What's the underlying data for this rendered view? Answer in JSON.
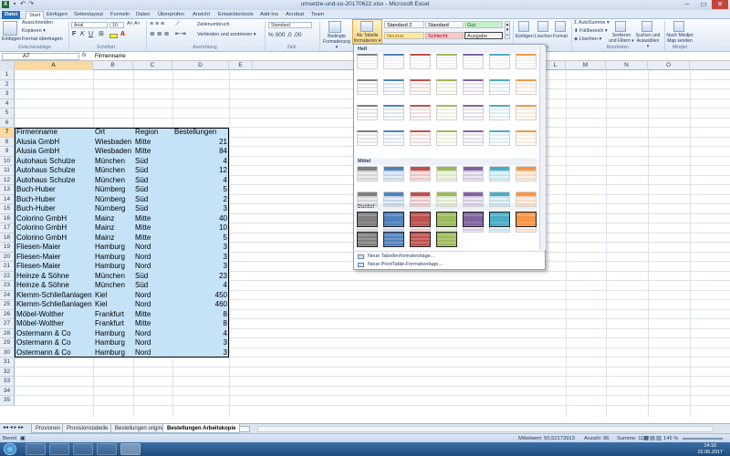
{
  "window": {
    "title": "umsetze-und-co-20170622.xlsx - Microsoft Excel"
  },
  "ribbon": {
    "tabs": [
      "Datei",
      "Start",
      "Einfügen",
      "Seitenlayout",
      "Formeln",
      "Daten",
      "Überprüfen",
      "Ansicht",
      "Entwicklertools",
      "Add-Ins",
      "Acrobat",
      "Team"
    ],
    "clipboard": {
      "paste": "Einfügen",
      "cut": "Ausschneiden",
      "copy": "Kopieren ▾",
      "format_painter": "Format übertragen",
      "group": "Zwischenablage"
    },
    "font": {
      "name": "Arial",
      "size": "10",
      "group": "Schriftart"
    },
    "alignment": {
      "wrap": "Zeilenumbruch",
      "merge": "Verbinden und zentrieren ▾",
      "group": "Ausrichtung"
    },
    "number": {
      "format": "Standard",
      "group": "Zahl"
    },
    "styles": {
      "conditional": "Bedingte Formatierung ▾",
      "as_table": "Als Tabelle formatieren ▾",
      "cells": [
        {
          "label": "Standard 2",
          "color": "#ffffff"
        },
        {
          "label": "Standard",
          "color": "#ffffff"
        },
        {
          "label": "Gut",
          "color": "#c6efce",
          "text": "#006100"
        },
        {
          "label": "Neutral",
          "color": "#ffeb9c",
          "text": "#9c6500"
        },
        {
          "label": "Schlecht",
          "color": "#ffc7ce",
          "text": "#9c0006"
        },
        {
          "label": "Ausgabe",
          "color": "#f2f2f2",
          "text": "#3f3f3f"
        }
      ]
    },
    "cells": {
      "insert": "Einfügen",
      "delete": "Löschen",
      "format": "Format",
      "group": "Zellen"
    },
    "editing": {
      "autosum": "AutoSumme ▾",
      "fill": "Füllbereich ▾",
      "clear": "Löschen ▾",
      "sort": "Sortieren und Filtern ▾",
      "find": "Suchen und Auswählen ▾",
      "group": "Bearbeiten"
    },
    "mindjet": {
      "send": "Nach Mindjet Map senden",
      "group": "Mindjet"
    }
  },
  "formula_bar": {
    "cell": "A7",
    "fx": "fx",
    "value": "Firmenname"
  },
  "columns": [
    "A",
    "B",
    "C",
    "D",
    "E",
    "F",
    "G",
    "H",
    "I",
    "J",
    "K",
    "L",
    "M",
    "N",
    "O"
  ],
  "selected_column": "A",
  "rows": [
    "1",
    "2",
    "3",
    "4",
    "5",
    "6",
    "7",
    "8",
    "9",
    "10",
    "11",
    "12",
    "13",
    "14",
    "15",
    "16",
    "17",
    "18",
    "19",
    "20",
    "21",
    "22",
    "23",
    "24",
    "25",
    "26",
    "27",
    "28",
    "29",
    "30",
    "31",
    "32",
    "33",
    "34",
    "35"
  ],
  "selected_row": "7",
  "table": {
    "headers": [
      "Firmenname",
      "Ort",
      "Region",
      "Bestellungen"
    ],
    "rows": [
      [
        "Alusia GmbH",
        "Wiesbaden",
        "Mitte",
        "21"
      ],
      [
        "Alusia GmbH",
        "Wiesbaden",
        "Mitte",
        "84"
      ],
      [
        "Autohaus Schulze",
        "München",
        "Süd",
        "4"
      ],
      [
        "Autohaus Schulze",
        "München",
        "Süd",
        "12"
      ],
      [
        "Autohaus Schulze",
        "München",
        "Süd",
        "4"
      ],
      [
        "Buch-Huber",
        "Nürnberg",
        "Süd",
        "5"
      ],
      [
        "Buch-Huber",
        "Nürnberg",
        "Süd",
        "2"
      ],
      [
        "Buch-Huber",
        "Nürnberg",
        "Süd",
        "3"
      ],
      [
        "Colorino GmbH",
        "Mainz",
        "Mitte",
        "40"
      ],
      [
        "Colorino GmbH",
        "Mainz",
        "Mitte",
        "10"
      ],
      [
        "Colorino GmbH",
        "Mainz",
        "Mitte",
        "5"
      ],
      [
        "Fliesen-Maier",
        "Hamburg",
        "Nord",
        "3"
      ],
      [
        "Fliesen-Maier",
        "Hamburg",
        "Nord",
        "3"
      ],
      [
        "Fliesen-Maier",
        "Hamburg",
        "Nord",
        "3"
      ],
      [
        "Heinze & Söhne",
        "München",
        "Süd",
        "23"
      ],
      [
        "Heinze & Söhne",
        "München",
        "Süd",
        "4"
      ],
      [
        "Klemm-Schließanlagen",
        "Kiel",
        "Nord",
        "450"
      ],
      [
        "Klemm-Schließanlagen",
        "Kiel",
        "Nord",
        "460"
      ],
      [
        "Möbel-Wolther",
        "Frankfurt",
        "Mitte",
        "8"
      ],
      [
        "Möbel-Wolther",
        "Frankfurt",
        "Mitte",
        "8"
      ],
      [
        "Ostermann & Co",
        "Hamburg",
        "Nord",
        "4"
      ],
      [
        "Ostermann & Co",
        "Hamburg",
        "Nord",
        "3"
      ],
      [
        "Ostermann & Co",
        "Hamburg",
        "Nord",
        "3"
      ]
    ]
  },
  "gallery": {
    "sections": [
      "Hell",
      "Mittel",
      "Dunkel"
    ],
    "menu": [
      "Neue Tabellenformatvorlage...",
      "Neue PivotTable-Formatvorlage..."
    ],
    "palette": [
      "#7f7f7f",
      "#4f81bd",
      "#c0504d",
      "#9bbb59",
      "#8064a2",
      "#4bacc6",
      "#f79646"
    ]
  },
  "sheets": {
    "tabs": [
      "Provionen",
      "Provisionstabelle",
      "Bestellungen original",
      "Bestellungen Arbeitskopie"
    ],
    "active": "Bestellungen Arbeitskopie"
  },
  "status": {
    "mode": "Bereit",
    "avg": "Mittelwert: 50,52173913",
    "count": "Anzahl: 96",
    "sum": "Summe: 1162",
    "zoom": "145 %"
  },
  "taskbar": {
    "time": "14:16",
    "date": "22.06.2017"
  }
}
